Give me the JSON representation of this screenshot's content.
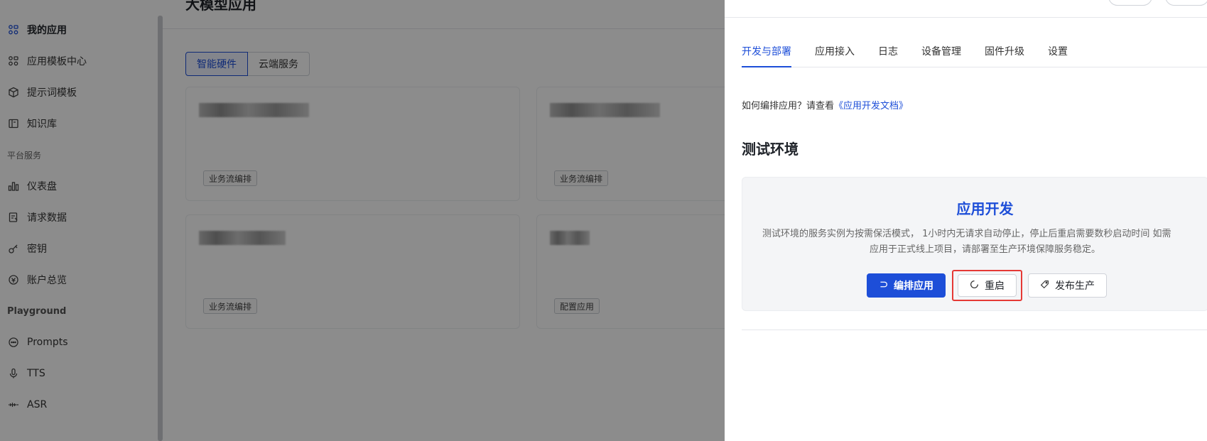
{
  "sidebar": {
    "items": [
      {
        "label": "我的应用",
        "icon": "apps-icon"
      },
      {
        "label": "应用模板中心",
        "icon": "template-icon"
      },
      {
        "label": "提示词模板",
        "icon": "cube-icon"
      },
      {
        "label": "知识库",
        "icon": "book-icon"
      }
    ],
    "section_platform": "平台服务",
    "platform_items": [
      {
        "label": "仪表盘",
        "icon": "bar-chart-icon"
      },
      {
        "label": "请求数据",
        "icon": "request-icon"
      },
      {
        "label": "密钥",
        "icon": "key-icon"
      },
      {
        "label": "账户总览",
        "icon": "account-icon"
      }
    ],
    "section_playground": "Playground",
    "playground_items": [
      {
        "label": "Prompts",
        "icon": "chat-icon"
      },
      {
        "label": "TTS",
        "icon": "mic-icon"
      },
      {
        "label": "ASR",
        "icon": "waveform-icon"
      }
    ]
  },
  "main": {
    "title": "大模型应用",
    "segments": [
      "智能硬件",
      "云端服务"
    ],
    "cards": [
      {
        "tag": "业务流编排"
      },
      {
        "tag": "业务流编排"
      },
      {
        "tag": "业务流编排"
      },
      {
        "tag": "配置应用"
      }
    ]
  },
  "drawer": {
    "tabs": [
      "开发与部署",
      "应用接入",
      "日志",
      "设备管理",
      "固件升级",
      "设置"
    ],
    "hint_prefix": "如何编排应用？请查看",
    "hint_link": "《应用开发文档》",
    "section_title": "测试环境",
    "env_title": "应用开发",
    "env_desc_line1": "测试环境的服务实例为按需保活模式， 1小时内无请求自动停止，停止后重启需要数秒启动时间 如需",
    "env_desc_line2": "应用于正式线上项目，请部署至生产环境保障服务稳定。",
    "btn_arrange": "编排应用",
    "btn_restart": "重启",
    "btn_publish": "发布生产"
  },
  "colors": {
    "accent": "#1d4ed8",
    "highlight": "#e53935"
  }
}
